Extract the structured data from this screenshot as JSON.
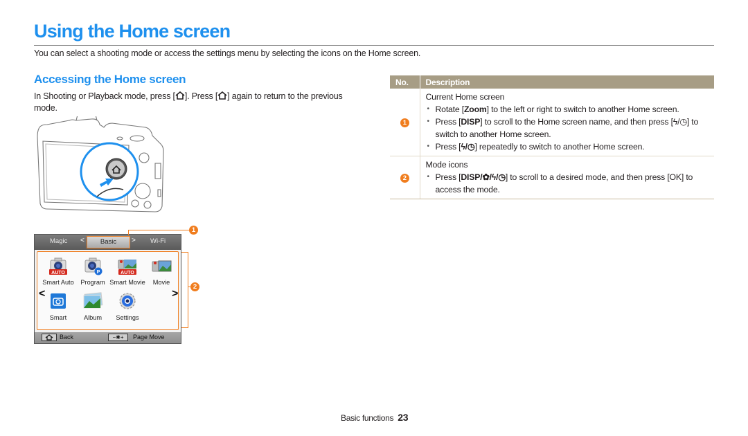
{
  "header": {
    "title": "Using the Home screen",
    "intro": "You can select a shooting mode or access the settings menu by selecting the icons on the Home screen."
  },
  "section": {
    "title": "Accessing the Home screen",
    "body_part1": "In Shooting or Playback mode, press [",
    "body_part2": "]. Press [",
    "body_part3": "] again to return to the previous mode."
  },
  "lcd": {
    "tabs": [
      "Magic",
      "Basic",
      "Wi-Fi"
    ],
    "active_tab": "Basic",
    "modes": [
      {
        "label": "Smart Auto",
        "icon": "smart-auto-icon"
      },
      {
        "label": "Program",
        "icon": "program-icon"
      },
      {
        "label": "Smart Movie",
        "icon": "smart-movie-icon"
      },
      {
        "label": "Movie",
        "icon": "movie-icon"
      },
      {
        "label": "Smart",
        "icon": "smart-icon"
      },
      {
        "label": "Album",
        "icon": "album-icon"
      },
      {
        "label": "Settings",
        "icon": "settings-icon"
      }
    ],
    "bottom": {
      "back_label": "Back",
      "page_move_label": "Page Move",
      "page_move_key": "−✱+"
    },
    "callouts": [
      "1",
      "2"
    ]
  },
  "table": {
    "headers": {
      "no": "No.",
      "description": "Description"
    },
    "rows": [
      {
        "no": "1",
        "title": "Current Home screen",
        "bullets": [
          {
            "pre": "Rotate [",
            "key": "Zoom",
            "post": "] to the left or right to switch to another Home screen."
          },
          {
            "pre": "Press [",
            "key": "DISP",
            "post": "] to scroll to the Home screen name, and then press [ϟ/◷] to switch to another Home screen."
          },
          {
            "pre": "Press [",
            "key": "ϟ/◷",
            "post": "] repeatedly to switch to another Home screen."
          }
        ]
      },
      {
        "no": "2",
        "title": "Mode icons",
        "bullets": [
          {
            "pre": "Press [",
            "key": "DISP/✿/ϟ/◷",
            "post": "] to scroll to a desired mode, and then press [OK] to access the mode."
          }
        ]
      }
    ]
  },
  "footer": {
    "section": "Basic functions",
    "page": "23"
  }
}
